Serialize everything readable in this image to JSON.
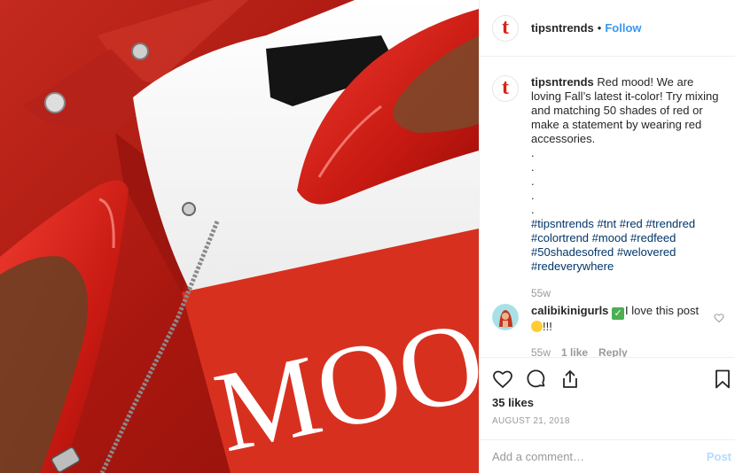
{
  "header": {
    "avatar_letter": "t",
    "username": "tipsntrends",
    "separator": "•",
    "follow_label": "Follow"
  },
  "caption": {
    "username": "tipsntrends",
    "text": " Red mood! We are loving Fall’s latest it-color! Try mixing and matching 50 shades of red or make a statement by wearing red accessories.\n.\n.\n.\n.\n.",
    "hashtags": [
      "#tipsntrends",
      "#tnt",
      "#red",
      "#trendred",
      "#colortrend",
      "#mood",
      "#redfeed",
      "#50shadesofred",
      "#welovered",
      "#redeverywhere"
    ],
    "time": "55w"
  },
  "comment": {
    "username": "calibikinigurls",
    "text_after_check": "I love this post",
    "text_after_emoji": "!!!",
    "time": "55w",
    "likes": "1 like",
    "reply_label": "Reply"
  },
  "photo": {
    "shirt_text": "MOO"
  },
  "actions": {
    "likes_count": "35 likes",
    "date": "AUGUST 21, 2018"
  },
  "add_comment": {
    "placeholder": "Add a comment…",
    "post_label": "Post"
  },
  "colors": {
    "link": "#3897f0",
    "hashtag": "#003569",
    "brand_red": "#d62418",
    "muted": "#999999"
  }
}
